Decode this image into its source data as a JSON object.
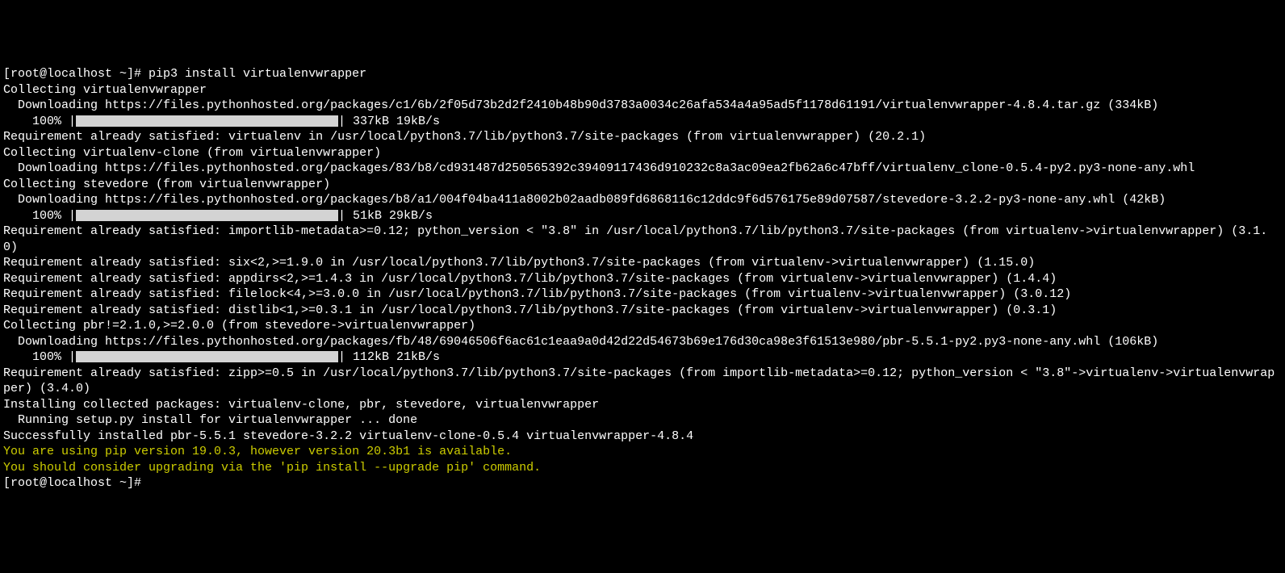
{
  "prompt1": "[root@localhost ~]# ",
  "command": "pip3 install virtualenvwrapper",
  "lines": [
    "Collecting virtualenvwrapper",
    "  Downloading https://files.pythonhosted.org/packages/c1/6b/2f05d73b2d2f2410b48b90d3783a0034c26afa534a4a95ad5f1178d61191/virtualenvwrapper-4.8.4.tar.gz (334kB)"
  ],
  "progress1": {
    "percent": "    100% |",
    "end": "| 337kB 19kB/s"
  },
  "lines2": [
    "Requirement already satisfied: virtualenv in /usr/local/python3.7/lib/python3.7/site-packages (from virtualenvwrapper) (20.2.1)",
    "Collecting virtualenv-clone (from virtualenvwrapper)",
    "  Downloading https://files.pythonhosted.org/packages/83/b8/cd931487d250565392c39409117436d910232c8a3ac09ea2fb62a6c47bff/virtualenv_clone-0.5.4-py2.py3-none-any.whl",
    "Collecting stevedore (from virtualenvwrapper)",
    "  Downloading https://files.pythonhosted.org/packages/b8/a1/004f04ba411a8002b02aadb089fd6868116c12ddc9f6d576175e89d07587/stevedore-3.2.2-py3-none-any.whl (42kB)"
  ],
  "progress2": {
    "percent": "    100% |",
    "end": "| 51kB 29kB/s"
  },
  "lines3": [
    "Requirement already satisfied: importlib-metadata>=0.12; python_version < \"3.8\" in /usr/local/python3.7/lib/python3.7/site-packages (from virtualenv->virtualenvwrapper) (3.1.0)",
    "Requirement already satisfied: six<2,>=1.9.0 in /usr/local/python3.7/lib/python3.7/site-packages (from virtualenv->virtualenvwrapper) (1.15.0)",
    "Requirement already satisfied: appdirs<2,>=1.4.3 in /usr/local/python3.7/lib/python3.7/site-packages (from virtualenv->virtualenvwrapper) (1.4.4)",
    "Requirement already satisfied: filelock<4,>=3.0.0 in /usr/local/python3.7/lib/python3.7/site-packages (from virtualenv->virtualenvwrapper) (3.0.12)",
    "Requirement already satisfied: distlib<1,>=0.3.1 in /usr/local/python3.7/lib/python3.7/site-packages (from virtualenv->virtualenvwrapper) (0.3.1)",
    "Collecting pbr!=2.1.0,>=2.0.0 (from stevedore->virtualenvwrapper)",
    "  Downloading https://files.pythonhosted.org/packages/fb/48/69046506f6ac61c1eaa9a0d42d22d54673b69e176d30ca98e3f61513e980/pbr-5.5.1-py2.py3-none-any.whl (106kB)"
  ],
  "progress3": {
    "percent": "    100% |",
    "end": "| 112kB 21kB/s"
  },
  "lines4": [
    "Requirement already satisfied: zipp>=0.5 in /usr/local/python3.7/lib/python3.7/site-packages (from importlib-metadata>=0.12; python_version < \"3.8\"->virtualenv->virtualenvwrapper) (3.4.0)",
    "Installing collected packages: virtualenv-clone, pbr, stevedore, virtualenvwrapper",
    "  Running setup.py install for virtualenvwrapper ... done",
    "Successfully installed pbr-5.5.1 stevedore-3.2.2 virtualenv-clone-0.5.4 virtualenvwrapper-4.8.4"
  ],
  "warnings": [
    "You are using pip version 19.0.3, however version 20.3b1 is available.",
    "You should consider upgrading via the 'pip install --upgrade pip' command."
  ],
  "prompt2": "[root@localhost ~]#"
}
